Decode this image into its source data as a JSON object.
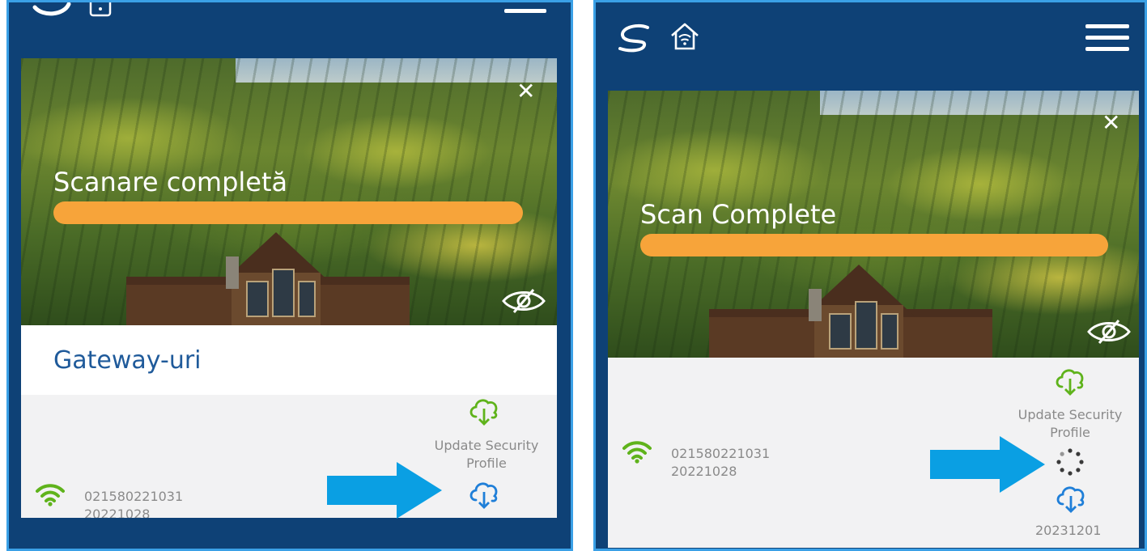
{
  "left_panel": {
    "hero_title": "Scanare completă",
    "section_title": "Gateway-uri",
    "update_label": "Update Security Profile",
    "device_id": "021580221031",
    "device_date": "20221028"
  },
  "right_panel": {
    "hero_title": "Scan Complete",
    "update_label": "Update Security Profile",
    "device_id": "021580221031",
    "device_date": "20221028",
    "profile_date": "20231201"
  },
  "icons": {
    "logo": "s-logo-icon",
    "home_wifi": "home-wifi-icon",
    "menu": "hamburger-menu-icon",
    "close": "close-icon",
    "hide": "eye-slash-icon",
    "wifi": "wifi-signal-icon",
    "cloud_green": "cloud-download-green-icon",
    "cloud_blue": "cloud-download-blue-icon",
    "spinner": "loading-spinner-icon",
    "arrow": "pointer-arrow-icon"
  },
  "colors": {
    "frame": "#0e4176",
    "border": "#3aa0e6",
    "progress": "#f7a43a",
    "title_blue": "#1f5a9a",
    "wifi_green": "#5fb31b",
    "cloud_blue": "#1f7fd8",
    "arrow_blue": "#0a9fe3"
  },
  "close_symbol": "✕"
}
